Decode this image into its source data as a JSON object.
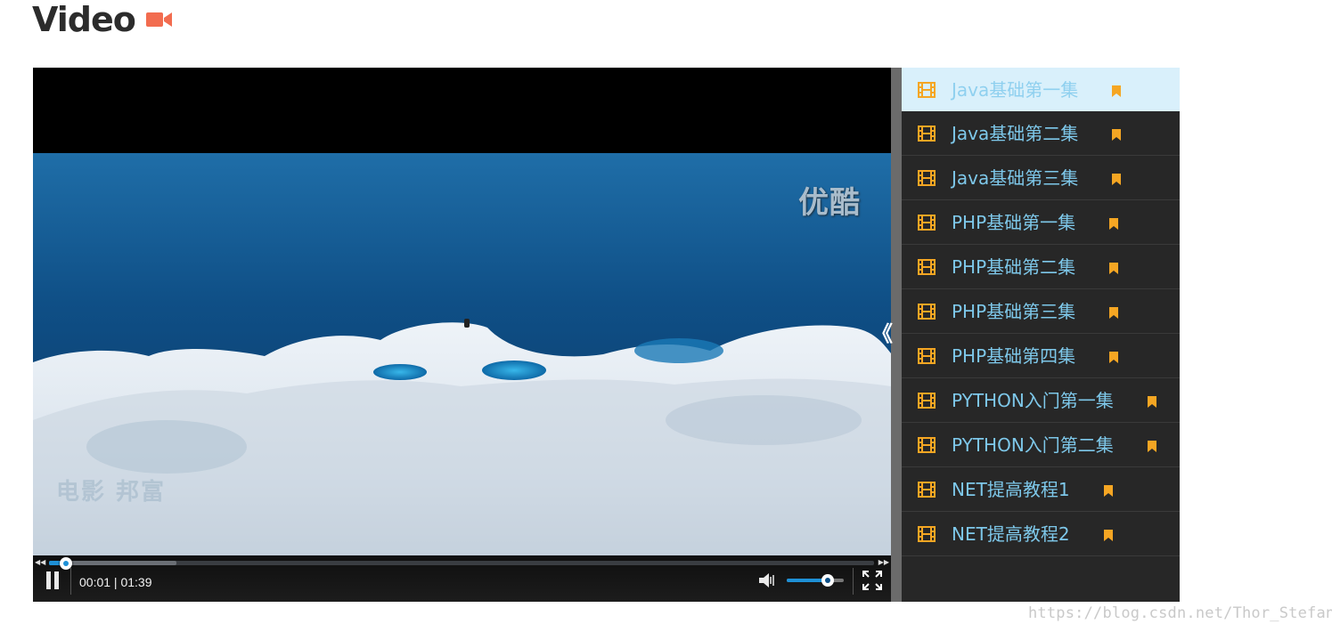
{
  "page": {
    "title": "Video",
    "title_icon": "video-camera-icon",
    "accent_color": "#f26c4f"
  },
  "player": {
    "watermark_top_right": "优酷",
    "watermark_bottom_left": "电影 邦富",
    "controls": {
      "time_display": "00:01 | 01:39",
      "progress_fraction": 0.01,
      "buffered_fraction": 0.154,
      "volume_fraction": 0.72,
      "play_state": "playing",
      "icons": [
        "pause-icon",
        "volume-icon",
        "fullscreen-icon",
        "skip-back-icon",
        "skip-forward-icon"
      ]
    },
    "seek_color": "#1e90d6"
  },
  "sidebar_toggle": "《",
  "playlist": {
    "active_index": 0,
    "items": [
      {
        "title": "Java基础第一集"
      },
      {
        "title": "Java基础第二集"
      },
      {
        "title": "Java基础第三集"
      },
      {
        "title": "PHP基础第一集"
      },
      {
        "title": "PHP基础第二集"
      },
      {
        "title": "PHP基础第三集"
      },
      {
        "title": "PHP基础第四集"
      },
      {
        "title": "PYTHON入门第一集"
      },
      {
        "title": "PYTHON入门第二集"
      },
      {
        "title": "NET提高教程1"
      },
      {
        "title": "NET提高教程2"
      }
    ],
    "icon_color": "#f5a623",
    "text_color": "#7ec8ea",
    "active_bg": "#d9f0fb"
  },
  "footer": {
    "watermark": "https://blog.csdn.net/Thor_Stefan"
  }
}
